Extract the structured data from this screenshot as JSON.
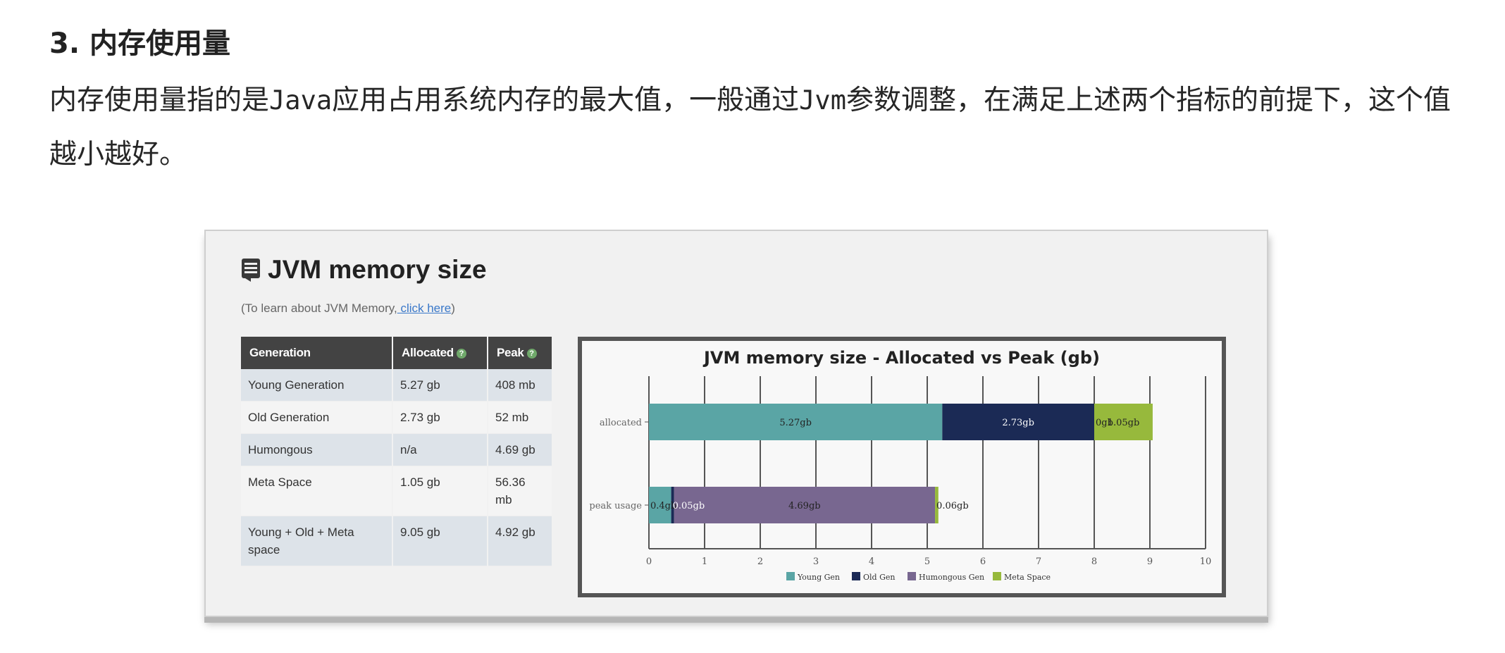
{
  "heading": "3. 内存使用量",
  "paragraph": {
    "p1": "内存使用量指的是",
    "m1": "Java",
    "p2": "应用占用系统内存的最大值，一般通过",
    "m2": "Jvm",
    "p3": "参数调整，在满足上述两个指标的前提下，这个值越小越好。"
  },
  "card": {
    "title": "JVM memory size",
    "subtitle_prefix": "(To learn about JVM Memory,",
    "subtitle_link": " click here",
    "subtitle_suffix": ")",
    "icon": "document-icon"
  },
  "table": {
    "headers": [
      "Generation",
      "Allocated",
      "Peak"
    ],
    "rows": [
      [
        "Young Generation",
        "5.27 gb",
        "408 mb"
      ],
      [
        "Old Generation",
        "2.73 gb",
        "52 mb"
      ],
      [
        "Humongous",
        "n/a",
        "4.69 gb"
      ],
      [
        "Meta Space",
        "1.05 gb",
        "56.36 mb"
      ],
      [
        "Young + Old + Meta space",
        "9.05 gb",
        "4.92 gb"
      ]
    ]
  },
  "chart_data": {
    "type": "bar",
    "orientation": "horizontal",
    "stacked": true,
    "title": "JVM memory size - Allocated vs Peak (gb)",
    "categories": [
      "allocated",
      "peak usage"
    ],
    "xlim": [
      0,
      10
    ],
    "xticks": [
      "0",
      "1",
      "2",
      "3",
      "4",
      "5",
      "6",
      "7",
      "8",
      "9",
      "10"
    ],
    "grid": true,
    "legend_position": "bottom",
    "series": [
      {
        "name": "Young Gen",
        "color": "#5aa5a5",
        "values": [
          5.27,
          0.4
        ],
        "labels": [
          "5.27gb",
          "0.4gb"
        ]
      },
      {
        "name": "Old Gen",
        "color": "#1b2a55",
        "values": [
          2.73,
          0.05
        ],
        "labels": [
          "2.73gb",
          "0.05gb"
        ]
      },
      {
        "name": "Humongous Gen",
        "color": "#786790",
        "values": [
          0,
          4.69
        ],
        "labels": [
          "0gb",
          "4.69gb"
        ]
      },
      {
        "name": "Meta Space",
        "color": "#97b93c",
        "values": [
          1.05,
          0.06
        ],
        "labels": [
          "1.05gb",
          "0.06gb"
        ]
      }
    ]
  }
}
